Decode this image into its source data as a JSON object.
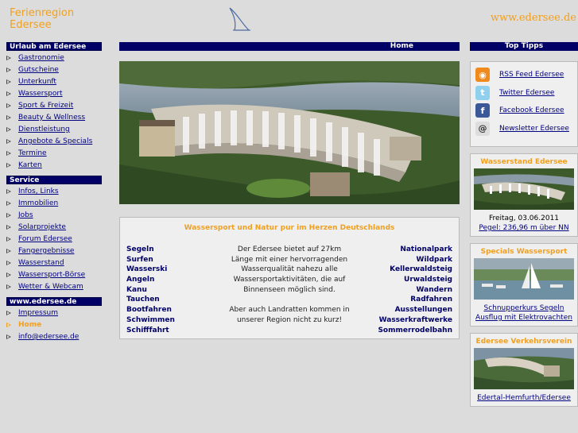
{
  "header": {
    "title_line1": "Ferienregion",
    "title_line2": "Edersee",
    "url": "www.edersee.de",
    "logo_icon": "sail-icon"
  },
  "sidebar": {
    "section1": {
      "title": "Urlaub am Edersee",
      "items": [
        "Gastronomie",
        "Gutscheine",
        "Unterkunft",
        "Wassersport",
        "Sport & Freizeit",
        "Beauty & Wellness",
        "Dienstleistung",
        "Angebote & Specials",
        "Termine",
        "Karten"
      ]
    },
    "section2": {
      "title": "Service",
      "items": [
        "Infos, Links",
        "Immobilien",
        "Jobs",
        "Solarprojekte",
        "Forum Edersee",
        "Fangergebnisse",
        "Wasserstand",
        "Wassersport-Börse",
        "Wetter & Webcam"
      ]
    },
    "section3": {
      "title": "www.edersee.de",
      "items": [
        "Impressum",
        "Home",
        "info@edersee.de"
      ],
      "active": "Home"
    }
  },
  "main": {
    "header": "Home",
    "content_title": "Wassersport und Natur pur im Herzen Deutschlands",
    "left_links": [
      "Segeln",
      "Surfen",
      "Wasserski",
      "Angeln",
      "Kanu",
      "Tauchen",
      "Bootfahren",
      "Schwimmen",
      "Schifffahrt"
    ],
    "right_links": [
      "Nationalpark",
      "Wildpark",
      "Kellerwaldsteig",
      "Urwaldsteig",
      "Wandern",
      "Radfahren",
      "Ausstellungen",
      "Wasserkraftwerke",
      "Sommerrodelbahn"
    ],
    "text1": "Der Edersee bietet auf 27km Länge mit einer hervorragenden Wasserqualität nahezu alle Wassersportaktivitäten, die auf Binnenseen möglich sind.",
    "text2": "Aber auch Landratten kommen in unserer Region nicht zu kurz!"
  },
  "right": {
    "header": "Top Tipps",
    "tips": [
      {
        "label": "RSS Feed Edersee",
        "icon": "rss-icon",
        "glyph": "◉"
      },
      {
        "label": "Twitter Edersee",
        "icon": "twitter-icon",
        "glyph": "t"
      },
      {
        "label": "Facebook Edersee",
        "icon": "facebook-icon",
        "glyph": "f"
      },
      {
        "label": "Newsletter Edersee",
        "icon": "at-icon",
        "glyph": "@"
      }
    ],
    "box1": {
      "title": "Wasserstand Edersee",
      "date": "Freitag, 03.06.2011",
      "link": "Pegel: 236,96 m über NN"
    },
    "box2": {
      "title": "Specials Wassersport",
      "link1": "Schnupperkurs Segeln",
      "link2": "Ausflug mit Elektrovachten"
    },
    "box3": {
      "title": "Edersee Verkehrsverein",
      "link": "Edertal-Hemfurth/Edersee"
    }
  },
  "colors": {
    "accent": "#f0a020",
    "nav": "#000066",
    "link": "#000080",
    "bg": "#dcdcdc"
  }
}
